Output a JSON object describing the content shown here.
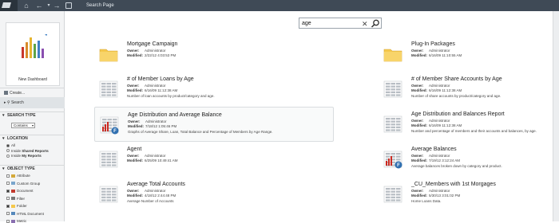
{
  "window": {
    "title": "Search Page"
  },
  "colors": {
    "topbar": "#3f4a56",
    "sidebar": "#f3f4f5",
    "accent_folder": "#f5c84c",
    "doc_red": "#cc2a21",
    "badge_blue": "#2f6fb0"
  },
  "sidebar": {
    "new_dashboard_label": "New Dashboard",
    "create_label": "Create...",
    "search_label": "Search",
    "search_type": {
      "header": "SEARCH TYPE",
      "selected": "Contains"
    },
    "location": {
      "header": "LOCATION",
      "options": [
        {
          "prefix": "All",
          "bold": "",
          "checked": true
        },
        {
          "prefix": "Inside ",
          "bold": "Shared Reports",
          "checked": false
        },
        {
          "prefix": "Inside ",
          "bold": "My Reports",
          "checked": false
        }
      ]
    },
    "object_type": {
      "header": "OBJECT TYPE",
      "items": [
        {
          "label": "Attribute",
          "checked": false,
          "icon": "attribute-icon",
          "color": "#d4a93a"
        },
        {
          "label": "Custom Group",
          "checked": false,
          "icon": "custom-group-icon",
          "color": "#7aa6cc"
        },
        {
          "label": "Document",
          "checked": true,
          "icon": "document-icon",
          "color": "#c23a2f"
        },
        {
          "label": "Filter",
          "checked": false,
          "icon": "filter-icon",
          "color": "#777777"
        },
        {
          "label": "Folder",
          "checked": true,
          "icon": "folder-icon",
          "color": "#f5c84c"
        },
        {
          "label": "HTML Document",
          "checked": false,
          "icon": "html-document-icon",
          "color": "#5588bb"
        },
        {
          "label": "Metric",
          "checked": false,
          "icon": "metric-icon",
          "color": "#8a6fb0"
        }
      ]
    }
  },
  "search": {
    "query": "age"
  },
  "results": [
    {
      "name": "Mortgage Campaign",
      "owner_label": "Owner:",
      "owner": "Administrator",
      "modified_label": "Modified:",
      "modified": "2/22/12 4:03:53 PM",
      "description": "",
      "icon": "folder-icon",
      "type": "folder"
    },
    {
      "name": "Plug-In Packages",
      "owner_label": "Owner:",
      "owner": "Administrator",
      "modified_label": "Modified:",
      "modified": "6/16/09 11:10:55 AM",
      "description": "",
      "icon": "folder-icon",
      "type": "folder"
    },
    {
      "name": "# of Member Loans by Age",
      "owner_label": "Owner:",
      "owner": "Administrator",
      "modified_label": "Modified:",
      "modified": "6/16/09 11:12:38 AM",
      "description": "Number of loan accounts by product/category and age.",
      "icon": "report-grid-icon",
      "type": "grid"
    },
    {
      "name": "# of Member Share Accounts by Age",
      "owner_label": "Owner:",
      "owner": "Administrator",
      "modified_label": "Modified:",
      "modified": "6/16/09 11:12:38 AM",
      "description": "Number of share accounts by product/category and age.",
      "icon": "report-grid-icon",
      "type": "grid"
    },
    {
      "name": "Age Distribution and Average Balance",
      "owner_label": "Owner:",
      "owner": "Administrator",
      "modified_label": "Modified:",
      "modified": "7/18/12 1:05:46 PM",
      "description": "Graphs of Average Share, Loan, Total Balance and Percentage of Members by Age Range.",
      "icon": "document-chart-icon",
      "type": "doc"
    },
    {
      "name": "Age Distribution and Balances Report",
      "owner_label": "Owner:",
      "owner": "Administrator",
      "modified_label": "Modified:",
      "modified": "6/16/09 11:12:38 AM",
      "description": "Number and percentage of members and their accounts and balances, by age.",
      "icon": "report-grid-icon",
      "type": "grid"
    },
    {
      "name": "Agent",
      "owner_label": "Owner:",
      "owner": "Administrator",
      "modified_label": "Modified:",
      "modified": "6/25/09 10:49:41 AM",
      "description": "",
      "icon": "report-grid-icon",
      "type": "grid"
    },
    {
      "name": "Average Balances",
      "owner_label": "Owner:",
      "owner": "Administrator",
      "modified_label": "Modified:",
      "modified": "7/19/12 3:12:24 AM",
      "description": "Average balances broken down by category and product.",
      "icon": "document-chart-icon",
      "type": "doc"
    },
    {
      "name": "Average Total Accounts",
      "owner_label": "Owner:",
      "owner": "Administrator",
      "modified_label": "Modified:",
      "modified": "4/18/12 2:44:48 PM",
      "description": "Average Number of Accounts",
      "icon": "report-grid-icon",
      "type": "grid"
    },
    {
      "name": "_CU_Members with 1st Morgages",
      "owner_label": "Owner:",
      "owner": "Administrator",
      "modified_label": "Modified:",
      "modified": "5/30/13 3:01:02 PM",
      "description": "Home Loans Data.",
      "icon": "report-grid-icon",
      "type": "grid"
    }
  ]
}
